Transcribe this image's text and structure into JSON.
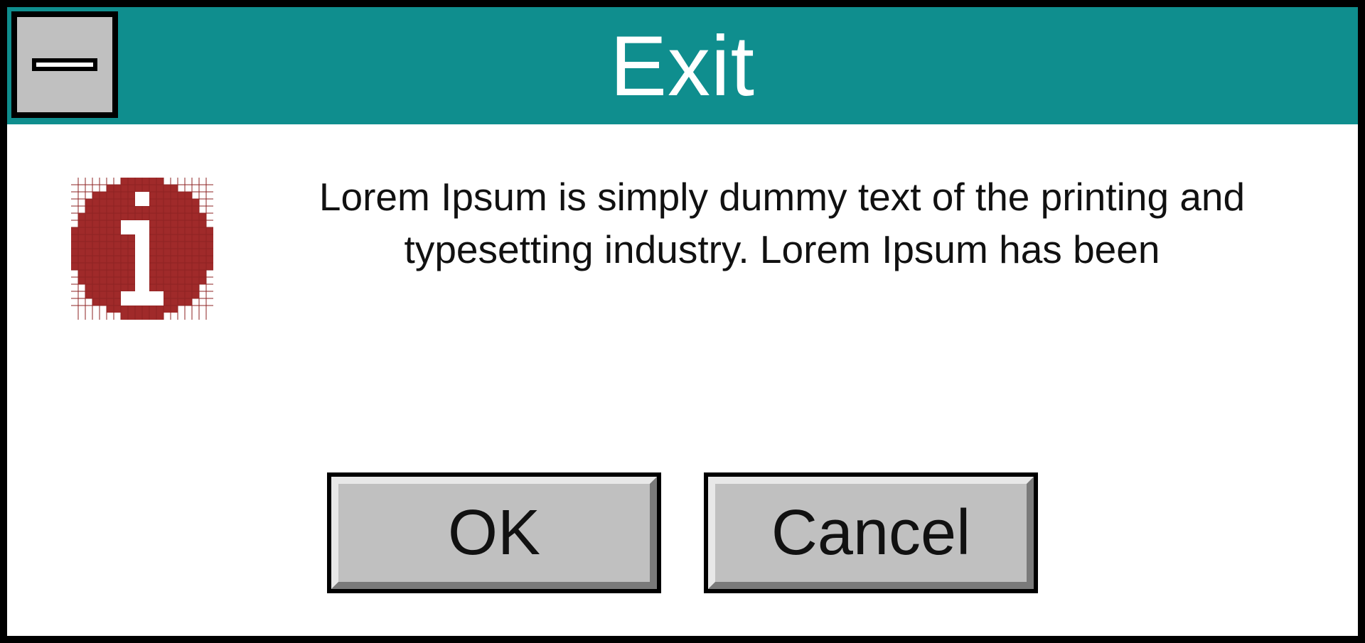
{
  "window": {
    "title": "Exit"
  },
  "message": {
    "text": "Lorem Ipsum is simply dummy text of the printing and typesetting industry. Lorem Ipsum has been"
  },
  "buttons": {
    "ok": "OK",
    "cancel": "Cancel"
  },
  "colors": {
    "titlebar": "#0f8e8e",
    "button_face": "#c0c0c0",
    "info_icon": "#a02a2a"
  }
}
